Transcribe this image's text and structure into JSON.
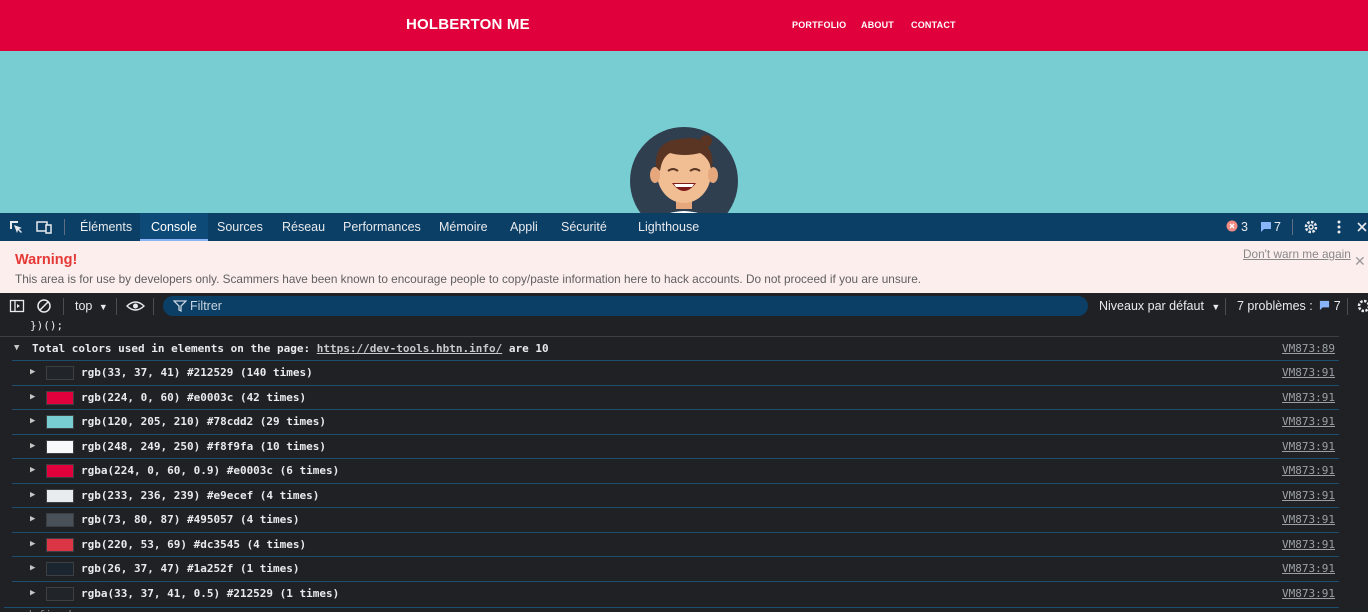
{
  "site": {
    "brand": "HOLBERTON ME",
    "nav": [
      "PORTFOLIO",
      "ABOUT",
      "CONTACT"
    ]
  },
  "devtools": {
    "tabs": [
      "Éléments",
      "Console",
      "Sources",
      "Réseau",
      "Performances",
      "Mémoire",
      "Appli",
      "Sécurité",
      "Lighthouse"
    ],
    "active_tab": "Console",
    "error_count": "3",
    "message_count": "7"
  },
  "warning": {
    "title": "Warning!",
    "body": "This area is for use by developers only. Scammers have been known to encourage people to copy/paste information here to hack accounts. Do not proceed if you are unsure.",
    "dismiss": "Don't warn me again"
  },
  "console_toolbar": {
    "context": "top",
    "filter_placeholder": "Filtrer",
    "levels": "Niveaux par défaut",
    "issues_label": "7 problèmes :",
    "issues_count": "7"
  },
  "console": {
    "prev_line": "})();",
    "group_prefix": "Total colors used in elements on the page:",
    "group_url": "https://dev-tools.hbtn.info/",
    "group_suffix": "are 10",
    "group_source": "VM873:89",
    "rows": [
      {
        "text": "rgb(33, 37, 41) #212529 (140 times)",
        "color": "#212529",
        "source": "VM873:91"
      },
      {
        "text": "rgb(224, 0, 60) #e0003c (42 times)",
        "color": "#e0003c",
        "source": "VM873:91"
      },
      {
        "text": "rgb(120, 205, 210) #78cdd2 (29 times)",
        "color": "#78cdd2",
        "source": "VM873:91"
      },
      {
        "text": "rgb(248, 249, 250) #f8f9fa (10 times)",
        "color": "#f8f9fa",
        "source": "VM873:91"
      },
      {
        "text": "rgba(224, 0, 60, 0.9) #e0003c (6 times)",
        "color": "#e0003c",
        "source": "VM873:91"
      },
      {
        "text": "rgb(233, 236, 239) #e9ecef (4 times)",
        "color": "#e9ecef",
        "source": "VM873:91"
      },
      {
        "text": "rgb(73, 80, 87) #495057 (4 times)",
        "color": "#495057",
        "source": "VM873:91"
      },
      {
        "text": "rgb(220, 53, 69) #dc3545 (4 times)",
        "color": "#dc3545",
        "source": "VM873:91"
      },
      {
        "text": "rgb(26, 37, 47) #1a252f (1 times)",
        "color": "#1a252f",
        "source": "VM873:91"
      },
      {
        "text": "rgba(33, 37, 41, 0.5) #212529 (1 times)",
        "color": "#212529",
        "source": "VM873:91"
      }
    ],
    "last_line": "undefined"
  }
}
